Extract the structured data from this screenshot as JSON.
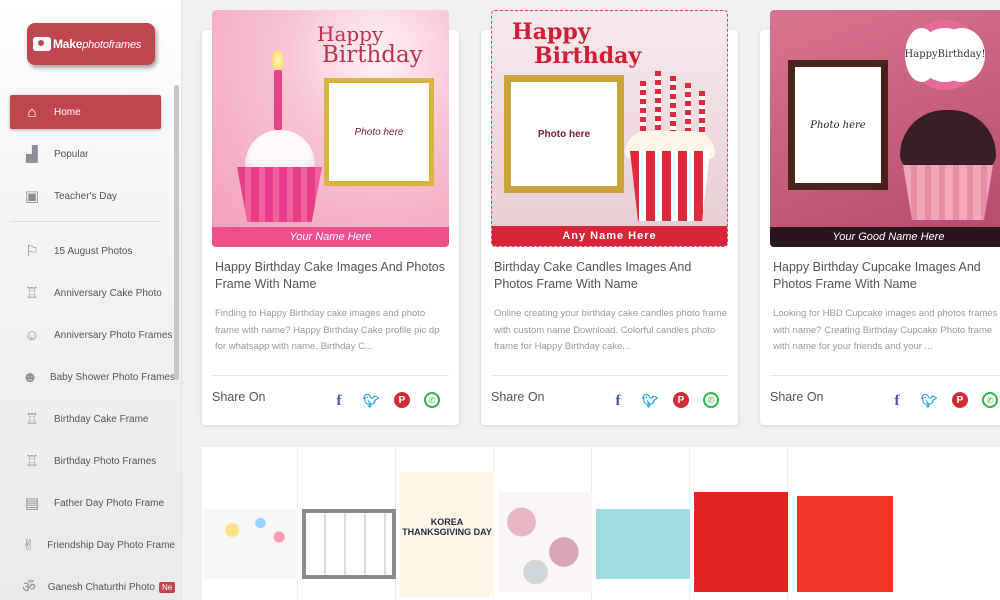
{
  "logo": {
    "brand_bold": "Make",
    "brand_light": "photoframes"
  },
  "sidebar": {
    "items": [
      {
        "label": "Home",
        "icon": "home-icon"
      },
      {
        "label": "Popular",
        "icon": "chart-icon"
      },
      {
        "label": "Teacher's Day",
        "icon": "teacher-icon"
      },
      {
        "label": "15 August Photos",
        "icon": "flag-icon"
      },
      {
        "label": "Anniversary Cake Photo",
        "icon": "cake-icon"
      },
      {
        "label": "Anniversary Photo Frames",
        "icon": "smile-icon"
      },
      {
        "label": "Baby Shower Photo Frames",
        "icon": "baby-icon"
      },
      {
        "label": "Birthday Cake Frame",
        "icon": "cake-icon"
      },
      {
        "label": "Birthday Photo Frames",
        "icon": "cake-icon"
      },
      {
        "label": "Father Day Photo Frame",
        "icon": "portrait-icon"
      },
      {
        "label": "Friendship Day Photo Frame",
        "icon": "peace-icon"
      },
      {
        "label": "Ganesh Chaturthi Photo",
        "icon": "om-icon",
        "badge": "Ne"
      }
    ]
  },
  "cards": [
    {
      "heading_top": "Happy",
      "heading_bottom": "Birthday",
      "photo_placeholder": "Photo here",
      "ribbon": "Your Name Here",
      "title": "Happy Birthday Cake Images And Photos Frame With Name",
      "description": "Finding to Happy Birthday cake images and photo frame with name? Happy Birthday Cake profile pic dp for whatsapp with name. Birthday C...",
      "share_label": "Share On"
    },
    {
      "heading_top": "Happy",
      "heading_bottom": "Birthday",
      "photo_placeholder": "Photo here",
      "ribbon": "Any Name Here",
      "title": "Birthday Cake Candles Images And Photos Frame With Name",
      "description": "Online creating your birthday cake candles photo frame with custom name Download. Colorful candles photo frame for Happy Birthday cake...",
      "share_label": "Share On"
    },
    {
      "tag_line1": "Happy",
      "tag_line2": "Birthday!",
      "photo_placeholder": "Photo here",
      "ribbon": "Your Good Name Here",
      "title": "Happy Birthday Cupcake Images And Photos Frame With Name",
      "description": "Looking for HBD Cupcake images and photos frames with name? Creating Birthday Cupcake Photo frame with name for your friends and your ...",
      "share_label": "Share On"
    }
  ],
  "share_icons": [
    "facebook-icon",
    "twitter-icon",
    "pinterest-icon",
    "whatsapp-icon"
  ],
  "ads": {
    "korea_line1": "KOREA",
    "korea_line2": "THANKSGIVING DAY"
  },
  "colors": {
    "accent": "#c0454f",
    "facebook": "#3b5998",
    "twitter": "#1da1f2",
    "pinterest": "#d52b35",
    "whatsapp": "#2bb741"
  }
}
